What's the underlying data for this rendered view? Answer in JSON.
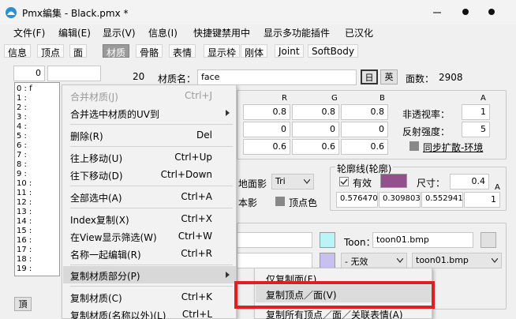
{
  "window": {
    "title": "Pmx編集 - Black.pmx *",
    "minimize_label": "—",
    "restore_label": "□",
    "close_label": "✕"
  },
  "menubar": [
    "文件(F)",
    "编辑(E)",
    "显示(V)",
    "信息(I)",
    "快捷键禁用中",
    "显示多功能插件",
    "已汉化"
  ],
  "tabs": [
    "信息",
    "顶点",
    "面",
    "材质",
    "骨骼",
    "表情",
    "显示枠",
    "刚体",
    "Joint",
    "SoftBody"
  ],
  "active_tab": "材质",
  "top_fields": {
    "index_value": "0",
    "name_value": "",
    "count_value": "20",
    "material_name_label": "材质名：",
    "material_name_value": "face",
    "jp_button": "日",
    "en_button": "英",
    "face_count_label": "面数：",
    "face_count_value": "2908"
  },
  "material_list": [
    "0 : f",
    "1 : ",
    "2 : ",
    "3 : ",
    "4 : ",
    "5 : ",
    "6 : ",
    "7 : ",
    "8 : ",
    "9 : ",
    "10 : ",
    "11 : ",
    "12 : ",
    "13 : ",
    "14 : ",
    "15 : ",
    "16 : ",
    "17 : ",
    "18 : ",
    "19 : "
  ],
  "color_table": {
    "headers": [
      "R",
      "G",
      "B",
      "A"
    ],
    "rows": [
      [
        "0.8",
        "0.8",
        "0.8"
      ],
      [
        "0",
        "0",
        "0"
      ],
      [
        "0.6",
        "0.6",
        "0.6"
      ]
    ],
    "opacity_label": "非透视率：",
    "opacity_value": "1",
    "reflect_label": "反射强度：",
    "reflect_value": "5",
    "sync_label": "同步扩散-环境"
  },
  "draw_options": {
    "ground_shadow_label": "地面影",
    "self_shadow_label": "本影",
    "tri_value": "Tri",
    "vertex_color_label": "顶点色"
  },
  "outline": {
    "group_label": "轮廓线(轮廓)",
    "valid_label": "有效",
    "size_label": "尺寸：",
    "size_value": "0.4",
    "a_label": "A",
    "color_values": [
      "0.576470",
      "0.309803",
      "0.552941",
      "1"
    ],
    "color_hex": "#93508d"
  },
  "texture": {
    "toon_label": "Toon：",
    "toon_value": "toon01.bmp",
    "sphere_value": "- 无效",
    "toon_select_value": "toon01.bmp"
  },
  "bottom_button": "頂",
  "context_menu": {
    "items": [
      {
        "label": "合并材质(J)",
        "shortcut": "Ctrl+J",
        "disabled": true
      },
      {
        "label": "合并选中材质的UV到",
        "shortcut": "",
        "submenu": true
      },
      {
        "label": "删除(R)",
        "shortcut": "Del"
      },
      {
        "label": "往上移动(U)",
        "shortcut": "Ctrl+Up"
      },
      {
        "label": "往下移动(D)",
        "shortcut": "Ctrl+Down"
      },
      {
        "label": "全部选中(A)",
        "shortcut": "Ctrl+A"
      },
      {
        "label": "Index复制(X)",
        "shortcut": "Ctrl+X"
      },
      {
        "label": "在View显示筛选(W)",
        "shortcut": "Ctrl+W"
      },
      {
        "label": "名称一起编辑(R)",
        "shortcut": "Ctrl+R"
      },
      {
        "label": "复制材质部分(P)",
        "shortcut": "",
        "submenu": true,
        "highlight": true
      },
      {
        "label": "复制材质(C)",
        "shortcut": "Ctrl+K"
      },
      {
        "label": "复制材质(名称以外)(L)",
        "shortcut": "Ctrl+L"
      }
    ]
  },
  "submenu": {
    "items": [
      {
        "label": "仅复制面(F)"
      },
      {
        "label": "复制顶点／面(V)"
      },
      {
        "label": "复制所有顶点／面／关联表情(A)"
      }
    ]
  }
}
